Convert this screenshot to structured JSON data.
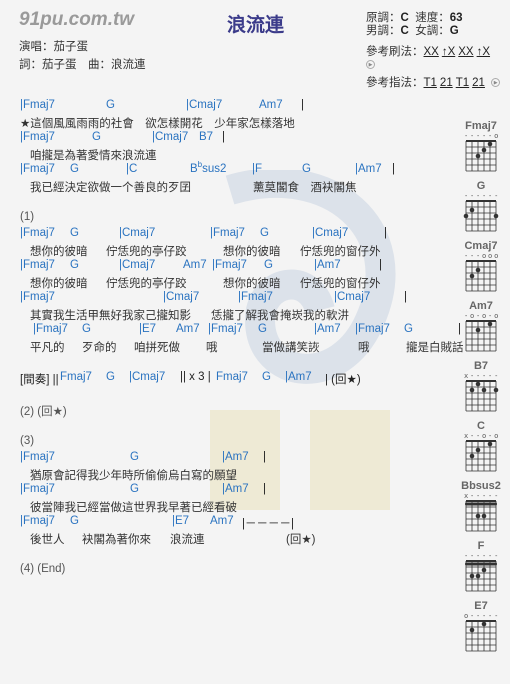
{
  "site": "91pu.com.tw",
  "song": {
    "title": "浪流連",
    "singer_label": "演唱：茄子蛋",
    "credits": "詞：茄子蛋　曲：浪流連"
  },
  "info": {
    "orig_key_label": "原調：",
    "orig_key": "C",
    "tempo_label": "速度：",
    "tempo": "63",
    "male_label": "男調：",
    "male_key": "C",
    "female_label": "女調：",
    "female_key": "G",
    "strum_label": "參考刷法：",
    "strum": [
      "XX",
      "↑X",
      "XX",
      "↑X"
    ],
    "pick_label": "參考指法：",
    "pick": [
      "T1",
      "21",
      "T1",
      "21"
    ]
  },
  "lines": {
    "l1": [
      "|Fmaj7",
      "G",
      "|Cmaj7",
      "Am7",
      "|"
    ],
    "y1": "★這個風風雨雨的社會　欲怎樣開花　少年家怎樣落地",
    "l2": [
      "|Fmaj7",
      "G",
      "|Cmaj7",
      "B7",
      "|"
    ],
    "y2": "咱攏是為著愛情來浪流連",
    "l3": [
      "|Fmaj7",
      "G",
      "|C",
      "B",
      "b",
      "sus2",
      "|F",
      "G",
      "|Am7",
      "|"
    ],
    "y3": [
      "我已經決定欲做一个善良的歹囝",
      "薰莫閣食　酒袂閣焦"
    ],
    "s1": "(1)",
    "l4": [
      "|Fmaj7",
      "G",
      "|Cmaj7",
      "|Fmaj7",
      "G",
      "|Cmaj7",
      "|"
    ],
    "y4": [
      "想你的彼暗",
      "佇恁兜的亭仔跤",
      "想你的彼暗",
      "佇恁兜的窗仔外"
    ],
    "l5": [
      "|Fmaj7",
      "G",
      "|Cmaj7",
      "Am7",
      "|Fmaj7",
      "G",
      "|Am7",
      "|"
    ],
    "y5": [
      "想你的彼暗",
      "佇恁兜的亭仔跤",
      "想你的彼暗",
      "佇恁兜的窗仔外"
    ],
    "l6": [
      "|Fmaj7",
      "|Cmaj7",
      "|Fmaj7",
      "|Cmaj7",
      "|"
    ],
    "y6": [
      "其實我生活甲無好我家己攏知影",
      "恁攏了解我會掩崁我的軟汫"
    ],
    "l7": [
      "|Fmaj7",
      "G",
      "|E7",
      "Am7",
      "|Fmaj7",
      "G",
      "|Am7",
      "|Fmaj7",
      "G",
      "|"
    ],
    "y7": [
      "平凡的",
      "歹命的",
      "咱拼死做",
      "哦",
      "當做講笑詼",
      "哦",
      "攏是白賊話"
    ],
    "inter": [
      "[間奏] ||",
      "Fmaj7",
      "G",
      "|Cmaj7",
      "|| x 3  |",
      "Fmaj7",
      "G",
      "|Am7",
      "|  (回★)"
    ],
    "s2": "(2) (回★)",
    "s3": "(3)",
    "l8": [
      "|Fmaj7",
      "G",
      "|Am7",
      "|"
    ],
    "y8": "猶原會記得我少年時所偷偷烏白寫的願望",
    "l9": [
      "|Fmaj7",
      "G",
      "|Am7",
      "|"
    ],
    "y9": "彼當陣我已經當做這世界我早著已經看破",
    "l10": [
      "|Fmaj7",
      "G",
      "|E7",
      "Am7",
      "|－－－－|"
    ],
    "y10": [
      "後世人",
      "袂閣為著你來",
      "浪流連",
      "(回★)"
    ],
    "s4": "(4) (End)"
  },
  "chords": [
    {
      "name": "Fmaj7",
      "marks": "-----o",
      "barre": 0,
      "dots": [
        [
          5,
          1
        ],
        [
          4,
          2
        ],
        [
          3,
          3
        ]
      ]
    },
    {
      "name": "G",
      "marks": "------",
      "barre": 0,
      "dots": [
        [
          2,
          2
        ],
        [
          1,
          3
        ],
        [
          6,
          3
        ]
      ]
    },
    {
      "name": "Cmaj7",
      "marks": "---ooo",
      "barre": 0,
      "dots": [
        [
          3,
          2
        ],
        [
          2,
          3
        ]
      ]
    },
    {
      "name": "Am7",
      "marks": "-o-o-o",
      "barre": 0,
      "dots": [
        [
          5,
          1
        ],
        [
          3,
          2
        ]
      ]
    },
    {
      "name": "B7",
      "marks": "x-----",
      "barre": 0,
      "dots": [
        [
          3,
          1
        ],
        [
          2,
          2
        ],
        [
          4,
          2
        ],
        [
          6,
          2
        ]
      ]
    },
    {
      "name": "C",
      "marks": "x--o-o",
      "barre": 0,
      "dots": [
        [
          5,
          1
        ],
        [
          3,
          2
        ],
        [
          2,
          3
        ]
      ]
    },
    {
      "name": "Bbsus2",
      "marks": "x-----",
      "barre": 1,
      "dots": [
        [
          3,
          3
        ],
        [
          4,
          3
        ]
      ]
    },
    {
      "name": "F",
      "marks": "------",
      "barre": 1,
      "dots": [
        [
          4,
          2
        ],
        [
          2,
          3
        ],
        [
          3,
          3
        ]
      ]
    },
    {
      "name": "E7",
      "marks": "o-----",
      "barre": 0,
      "dots": [
        [
          2,
          2
        ],
        [
          4,
          1
        ]
      ]
    }
  ]
}
